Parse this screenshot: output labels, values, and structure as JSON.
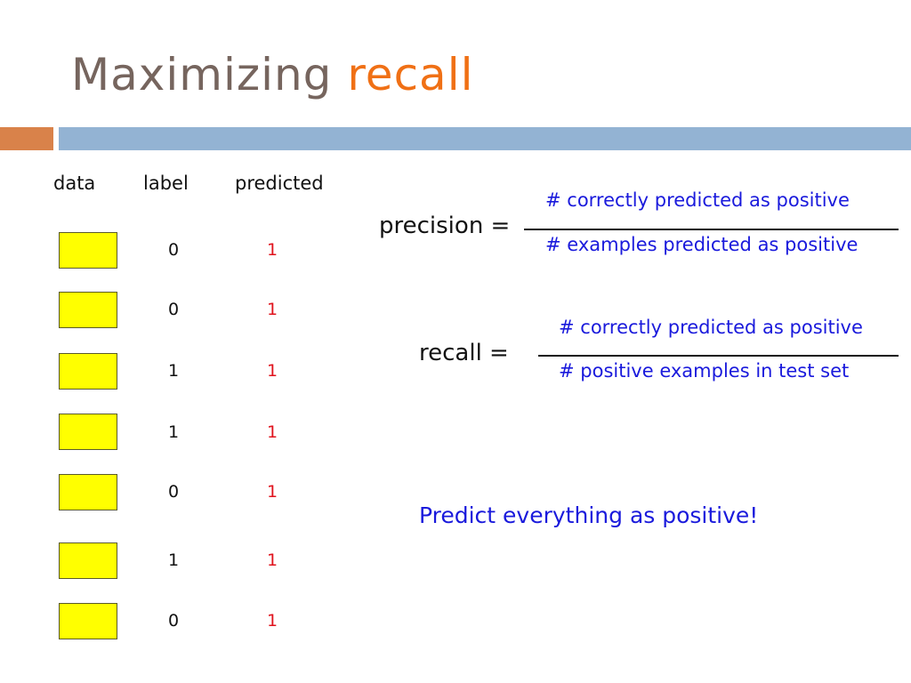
{
  "slide": {
    "title_prefix": "Maximizing",
    "title_highlight": "recall",
    "colors": {
      "title_text": "#76655e",
      "title_highlight": "#f07015",
      "accent_bar_left": "#d9824a",
      "accent_bar_right": "#93b3d3",
      "data_box": "#ffff00",
      "predicted_text": "#e0141e",
      "formula_text": "#1a1adc"
    }
  },
  "table": {
    "headers": {
      "data": "data",
      "label": "label",
      "predicted": "predicted"
    },
    "rows": [
      {
        "label": "0",
        "predicted": "1"
      },
      {
        "label": "0",
        "predicted": "1"
      },
      {
        "label": "1",
        "predicted": "1"
      },
      {
        "label": "1",
        "predicted": "1"
      },
      {
        "label": "0",
        "predicted": "1"
      },
      {
        "label": "1",
        "predicted": "1"
      },
      {
        "label": "0",
        "predicted": "1"
      }
    ]
  },
  "formulas": {
    "precision": {
      "lhs": "precision =",
      "numerator": "# correctly predicted as positive",
      "denominator": "# examples predicted as positive"
    },
    "recall": {
      "lhs": "recall =",
      "numerator": "# correctly predicted as positive",
      "denominator": "# positive examples in test set"
    }
  },
  "callout": "Predict everything as positive!"
}
